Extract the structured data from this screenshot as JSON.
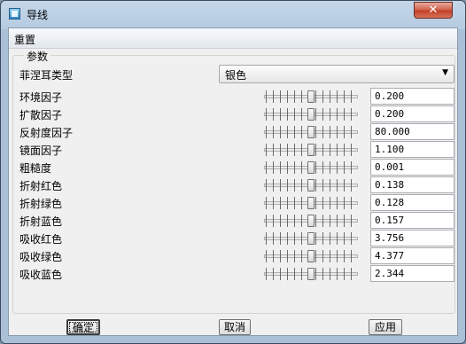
{
  "window": {
    "title": "导线"
  },
  "menu": {
    "items": [
      "重置"
    ]
  },
  "group": {
    "title": "参数"
  },
  "fresnel": {
    "label": "菲涅耳类型",
    "selected": "银色"
  },
  "params": [
    {
      "label": "环境因子",
      "value": "0.200",
      "level": 0.5
    },
    {
      "label": "扩散因子",
      "value": "0.200",
      "level": 0.5
    },
    {
      "label": "反射度因子",
      "value": "80.000",
      "level": 0.5
    },
    {
      "label": "镜面因子",
      "value": "1.100",
      "level": 0.5
    },
    {
      "label": "粗糙度",
      "value": "0.001",
      "level": 0.5
    },
    {
      "label": "折射红色",
      "value": "0.138",
      "level": 0.5
    },
    {
      "label": "折射绿色",
      "value": "0.128",
      "level": 0.5
    },
    {
      "label": "折射蓝色",
      "value": "0.157",
      "level": 0.5
    },
    {
      "label": "吸收红色",
      "value": "3.756",
      "level": 0.5
    },
    {
      "label": "吸收绿色",
      "value": "4.377",
      "level": 0.5
    },
    {
      "label": "吸收蓝色",
      "value": "2.344",
      "level": 0.5
    }
  ],
  "buttons": {
    "ok": "确定",
    "cancel": "取消",
    "apply": "应用"
  }
}
